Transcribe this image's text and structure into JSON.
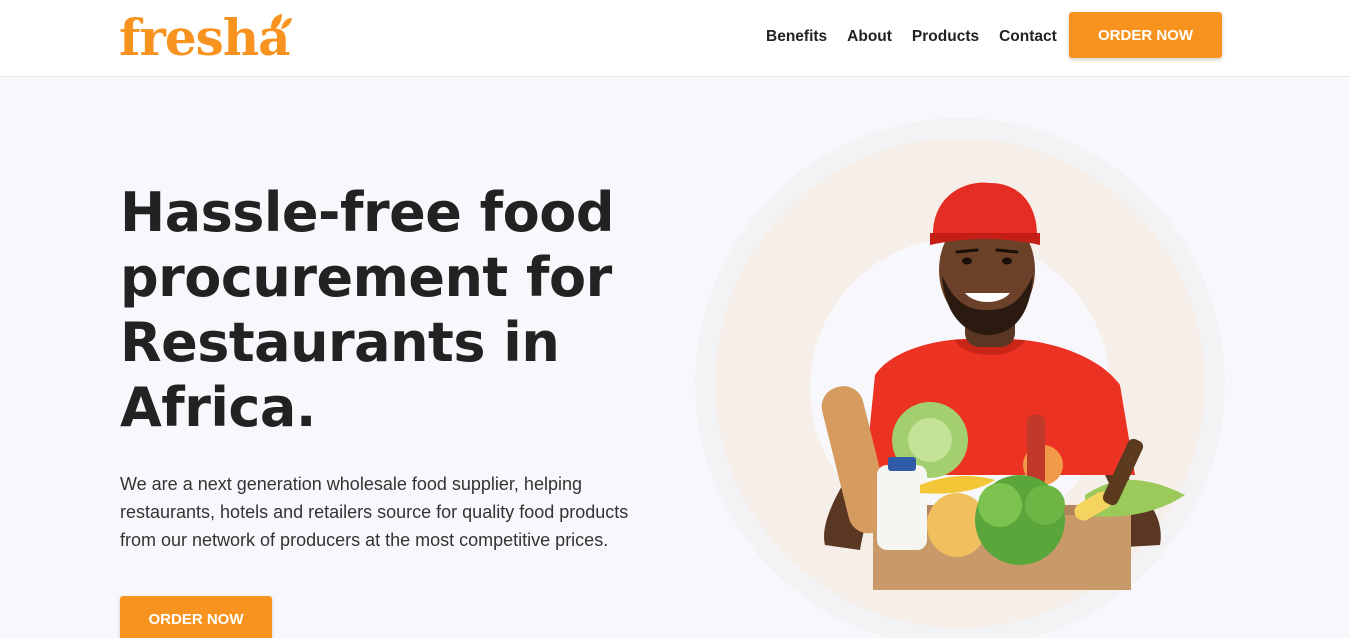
{
  "header": {
    "logo_text": "fresha",
    "nav": [
      {
        "label": "Benefits"
      },
      {
        "label": "About"
      },
      {
        "label": "Products"
      },
      {
        "label": "Contact"
      }
    ],
    "cta_label": "ORDER NOW"
  },
  "hero": {
    "title_lines": [
      "Hassle-free food",
      "procurement for",
      "Restaurants in",
      "Africa."
    ],
    "description_lines": [
      "We are a next generation wholesale food supplier, helping",
      "restaurants, hotels and retailers source for quality food products",
      "from our network of producers at the most competitive prices."
    ],
    "cta_label": "ORDER NOW",
    "image_icon": "delivery-person-with-groceries-image"
  },
  "colors": {
    "brand_orange": "#f7931e",
    "text_dark": "#222222",
    "shirt_red": "#ec3323"
  }
}
